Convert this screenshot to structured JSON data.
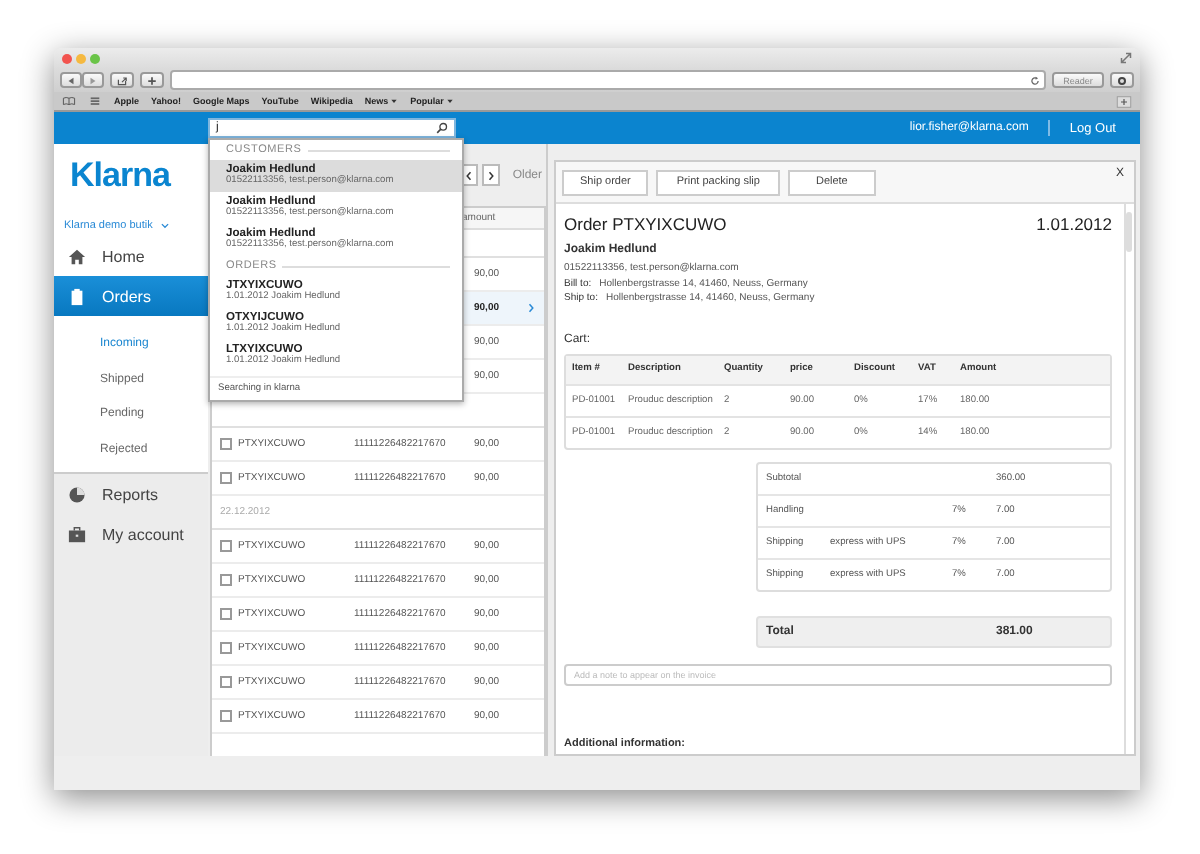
{
  "browser": {
    "bookmarks": [
      {
        "label": "Apple",
        "menu": false
      },
      {
        "label": "Yahoo!",
        "menu": false
      },
      {
        "label": "Google Maps",
        "menu": false
      },
      {
        "label": "YouTube",
        "menu": false
      },
      {
        "label": "Wikipedia",
        "menu": false
      },
      {
        "label": "News",
        "menu": true
      },
      {
        "label": "Popular",
        "menu": true
      }
    ],
    "reader": {
      "label": "Reader",
      "disabled": true
    }
  },
  "header": {
    "search": {
      "value": "j"
    },
    "user": "lior.fisher@klarna.com",
    "logout": "Log Out"
  },
  "search_results": {
    "sections": [
      {
        "title": "CUSTOMERS",
        "items": [
          {
            "title": "Joakim Hedlund",
            "subtitle": "01522113356, test.person@klarna.com",
            "selected": true
          },
          {
            "title": "Joakim Hedlund",
            "subtitle": "01522113356, test.person@klarna.com",
            "selected": false
          },
          {
            "title": "Joakim Hedlund",
            "subtitle": "01522113356, test.person@klarna.com",
            "selected": false
          }
        ]
      },
      {
        "title": "ORDERS",
        "items": [
          {
            "title": "JTXYIXCUWO",
            "subtitle": "1.01.2012  Joakim Hedlund",
            "selected": false
          },
          {
            "title": "OTXYIJCUWO",
            "subtitle": "1.01.2012  Joakim Hedlund",
            "selected": false
          },
          {
            "title": "LTXYIXCUWO",
            "subtitle": "1.01.2012  Joakim Hedlund",
            "selected": false
          }
        ]
      }
    ],
    "footer": "Searching in klarna"
  },
  "sidebar": {
    "logo": "Klarna",
    "store": "Klarna demo butik",
    "nav": [
      {
        "label": "Home",
        "selected": false
      },
      {
        "label": "Orders",
        "selected": true,
        "children": [
          {
            "label": "Incoming",
            "selected": true
          },
          {
            "label": "Shipped",
            "selected": false
          },
          {
            "label": "Pending",
            "selected": false
          },
          {
            "label": "Rejected",
            "selected": false
          }
        ]
      }
    ],
    "secondary": [
      {
        "label": "Reports",
        "selected": false
      },
      {
        "label": "My account",
        "selected": false
      }
    ]
  },
  "order_list": {
    "older": "Older",
    "column": "amount",
    "groups": [
      {
        "rows": [
          {
            "amount": "90,00",
            "selected": false
          },
          {
            "amount": "90,00",
            "selected": true
          },
          {
            "amount": "90,00",
            "selected": false
          },
          {
            "amount": "90,00",
            "selected": false
          }
        ]
      },
      {
        "rows": [
          {
            "id": "PTXYIXCUWO",
            "number": "11111226482217670",
            "amount": "90,00",
            "checked": false,
            "selected": false
          },
          {
            "id": "PTXYIXCUWO",
            "number": "11111226482217670",
            "amount": "90,00",
            "checked": false,
            "selected": false
          }
        ]
      },
      {
        "date": "22.12.2012",
        "rows": [
          {
            "id": "PTXYIXCUWO",
            "number": "11111226482217670",
            "amount": "90,00",
            "checked": false,
            "selected": false
          },
          {
            "id": "PTXYIXCUWO",
            "number": "11111226482217670",
            "amount": "90,00",
            "checked": false,
            "selected": false
          },
          {
            "id": "PTXYIXCUWO",
            "number": "11111226482217670",
            "amount": "90,00",
            "checked": false,
            "selected": false
          },
          {
            "id": "PTXYIXCUWO",
            "number": "11111226482217670",
            "amount": "90,00",
            "checked": false,
            "selected": false
          },
          {
            "id": "PTXYIXCUWO",
            "number": "11111226482217670",
            "amount": "90,00",
            "checked": false,
            "selected": false
          },
          {
            "id": "PTXYIXCUWO",
            "number": "11111226482217670",
            "amount": "90,00",
            "checked": false,
            "selected": false
          }
        ]
      }
    ]
  },
  "order": {
    "actions": [
      "Ship order",
      "Print packing slip",
      "Delete"
    ],
    "close": "X",
    "title": "Order PTXYIXCUWO",
    "date": "1.01.2012",
    "customer": "Joakim Hedlund",
    "contact": "01522113356, test.person@klarna.com",
    "addresses": [
      {
        "label": "Bill to:",
        "value": "Hollenbergstrasse 14, 41460, Neuss, Germany"
      },
      {
        "label": "Ship to:",
        "value": "Hollenbergstrasse 14, 41460, Neuss, Germany"
      }
    ],
    "cart_label": "Cart:",
    "cart": {
      "columns": [
        "Item #",
        "Description",
        "Quantity",
        "price",
        "Discount",
        "VAT",
        "Amount"
      ],
      "rows": [
        [
          "PD-01001",
          "Prouduc description",
          "2",
          "90.00",
          "0%",
          "17%",
          "180.00"
        ],
        [
          "PD-01001",
          "Prouduc description",
          "2",
          "90.00",
          "0%",
          "14%",
          "180.00"
        ]
      ]
    },
    "summary": [
      {
        "label": "Subtotal",
        "amount": "360.00"
      },
      {
        "label": "Handling",
        "rate": "7%",
        "amount": "7.00"
      },
      {
        "label": "Shipping",
        "detail": "express with UPS",
        "rate": "7%",
        "amount": "7.00"
      },
      {
        "label": "Shipping",
        "detail": "express with UPS",
        "rate": "7%",
        "amount": "7.00"
      }
    ],
    "total": {
      "label": "Total",
      "value": "381.00"
    },
    "note": {
      "placeholder": "Add a note to appear on the invoice"
    },
    "additional": "Additional information:"
  }
}
